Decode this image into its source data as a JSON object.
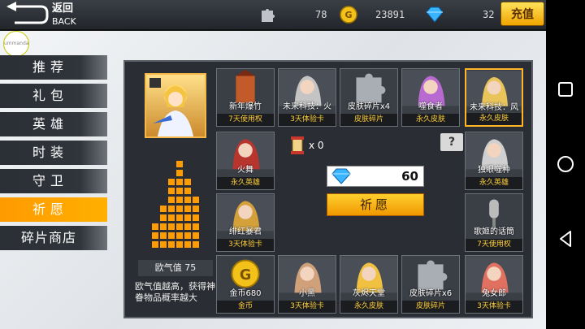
{
  "header": {
    "back_cn": "返回",
    "back_en": "BACK",
    "stars": "78",
    "coins": "23891",
    "diamonds": "32",
    "recharge": "充值"
  },
  "badge": "ummanda",
  "sidebar": {
    "items": [
      {
        "label": "推荐"
      },
      {
        "label": "礼包"
      },
      {
        "label": "英雄"
      },
      {
        "label": "时装"
      },
      {
        "label": "守卫"
      },
      {
        "label": "祈愿"
      },
      {
        "label": "碎片商店"
      }
    ],
    "active_index": 5
  },
  "wish": {
    "luck_label": "欧气值 75",
    "luck_value": 75,
    "desc": "欧气值越高，获得神眷物品概率越大",
    "scroll_count": "x 0",
    "help": "?",
    "cost": "60",
    "pray_label": "祈愿"
  },
  "slots": [
    {
      "name": "新年爆竹",
      "type": "7天使用权",
      "art": "firecracker-icon"
    },
    {
      "name": "未来科技：火",
      "type": "3天体验卡",
      "art": "hero-portrait"
    },
    {
      "name": "皮肤碎片x4",
      "type": "皮肤碎片",
      "art": "puzzle-icon"
    },
    {
      "name": "噬食者",
      "type": "永久皮肤",
      "art": "hero-portrait"
    },
    {
      "name": "未来科技：风",
      "type": "永久皮肤",
      "art": "hero-portrait"
    },
    {
      "name": "火舞",
      "type": "永久英雄",
      "art": "hero-portrait"
    },
    {
      "name": "独眼噬种",
      "type": "永久英雄",
      "art": "hero-portrait"
    },
    {
      "name": "绯红暴君",
      "type": "3天体验卡",
      "art": "hero-portrait"
    },
    {
      "name": "歌姬的话筒",
      "type": "7天使用权",
      "art": "microphone-icon"
    },
    {
      "name": "金币680",
      "type": "金币",
      "art": "coin-icon"
    },
    {
      "name": "小黑",
      "type": "3天体验卡",
      "art": "hero-portrait"
    },
    {
      "name": "灰烬天堂",
      "type": "永久皮肤",
      "art": "hero-portrait"
    },
    {
      "name": "皮肤碎片x6",
      "type": "皮肤碎片",
      "art": "puzzle-icon"
    },
    {
      "name": "兔女郎",
      "type": "3天体验卡",
      "art": "hero-portrait"
    }
  ],
  "colors": {
    "accent": "#ffa800",
    "panel": "#2a2d33",
    "type_text": "#ffce3a"
  }
}
